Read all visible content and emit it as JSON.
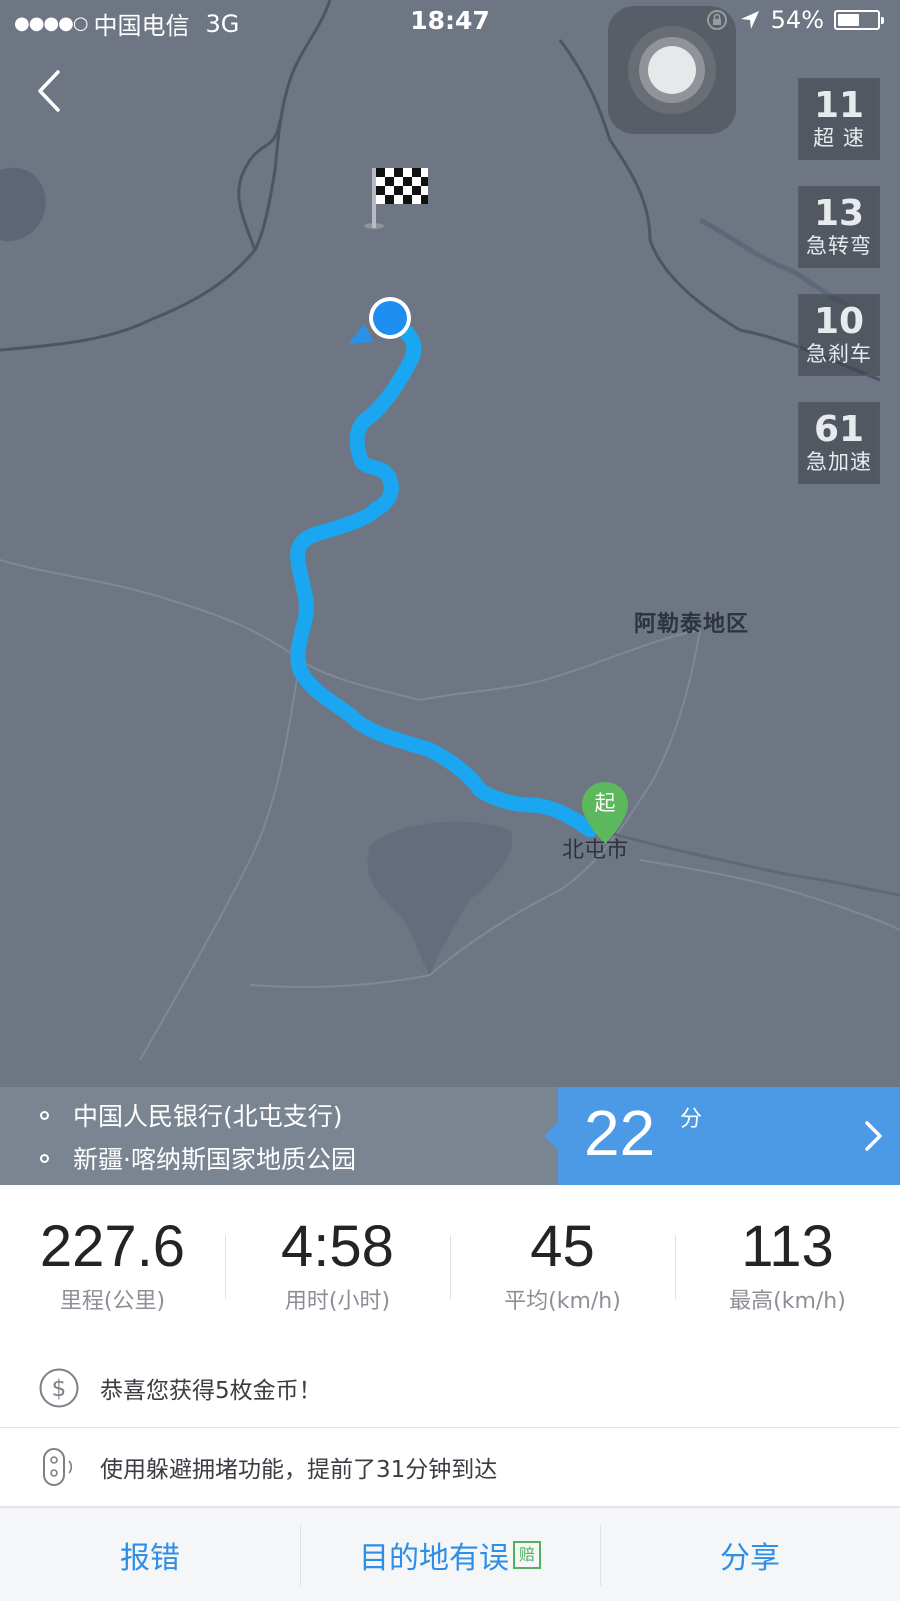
{
  "status_bar": {
    "signal": "●●●●○",
    "carrier": "中国电信",
    "network": "3G",
    "time": "18:47",
    "battery_percent_text": "54%",
    "battery_level": 0.54
  },
  "map": {
    "labels": {
      "region": "阿勒泰地区",
      "city": "北屯市"
    },
    "start_marker": "起"
  },
  "badges": [
    {
      "count": "11",
      "label": "超 速"
    },
    {
      "count": "13",
      "label": "急转弯"
    },
    {
      "count": "10",
      "label": "急刹车"
    },
    {
      "count": "61",
      "label": "急加速"
    }
  ],
  "route": {
    "from": "中国人民银行(北屯支行)",
    "to": "新疆·喀纳斯国家地质公园",
    "minutes": "22",
    "minutes_unit": "分"
  },
  "stats": [
    {
      "value": "227.6",
      "label": "里程(公里)"
    },
    {
      "value": "4:58",
      "label": "用时(小时)"
    },
    {
      "value": "45",
      "label": "平均(km/h)"
    },
    {
      "value": "113",
      "label": "最高(km/h)"
    }
  ],
  "info": {
    "coins": "恭喜您获得5枚金币！",
    "avoid": "使用躲避拥堵功能，提前了31分钟到达"
  },
  "actions": {
    "report": "报错",
    "wrong_destination": "目的地有误",
    "compensate_badge": "赔",
    "share": "分享"
  },
  "colors": {
    "route": "#1aa6f0",
    "accent_blue": "#4c9ae6",
    "start_green": "#5cb85c",
    "map_bg": "#6e7683"
  },
  "icons": {
    "back": "chevron-left-icon",
    "finish": "checkered-flag-icon",
    "current": "location-dot-icon",
    "coins": "dollar-coin-icon",
    "avoid": "traffic-light-icon",
    "chevron": "chevron-right-icon"
  }
}
